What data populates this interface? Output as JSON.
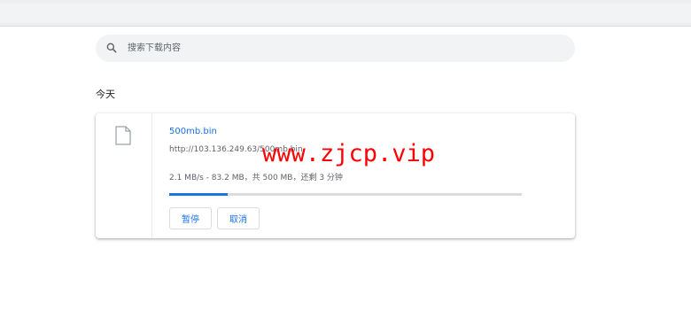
{
  "search": {
    "placeholder": "搜索下载内容"
  },
  "section": {
    "date_label": "今天"
  },
  "download": {
    "filename": "500mb.bin",
    "url": "http://103.136.249.63/500mb.bin",
    "status": "2.1 MB/s - 83.2 MB，共 500 MB，还剩 3 分钟",
    "progress_fraction": 0.166,
    "pause_label": "暂停",
    "cancel_label": "取消"
  },
  "watermark": {
    "text": "www.zjcp.vip",
    "color": "#ff0000"
  },
  "colors": {
    "accent": "#1a73e8",
    "track": "#dadce0",
    "search_bg": "#f1f3f4"
  },
  "icons": {
    "search": "search-icon",
    "file": "file-icon"
  }
}
